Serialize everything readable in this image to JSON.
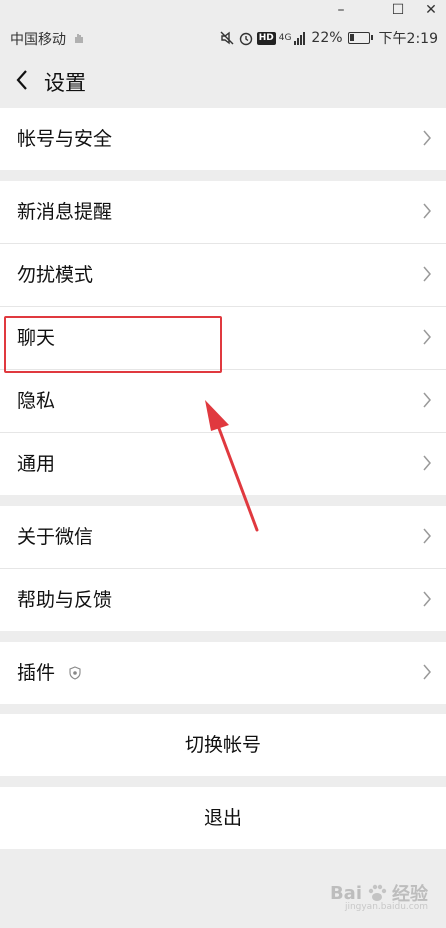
{
  "window": {
    "minimize": "–",
    "maximize": "☐",
    "close": "✕"
  },
  "status": {
    "carrier": "中国移动",
    "hd": "HD",
    "network": "4G",
    "battery": "22%",
    "time": "下午2:19"
  },
  "header": {
    "title": "设置"
  },
  "groups": [
    {
      "items": [
        {
          "label": "帐号与安全"
        }
      ]
    },
    {
      "items": [
        {
          "label": "新消息提醒"
        },
        {
          "label": "勿扰模式"
        },
        {
          "label": "聊天"
        },
        {
          "label": "隐私"
        },
        {
          "label": "通用"
        }
      ]
    },
    {
      "items": [
        {
          "label": "关于微信"
        },
        {
          "label": "帮助与反馈"
        }
      ]
    },
    {
      "items": [
        {
          "label": "插件"
        }
      ]
    }
  ],
  "actions": {
    "switch_account": "切换帐号",
    "logout": "退出"
  },
  "annotation": {
    "highlight_color": "#e0393f"
  },
  "watermark": {
    "text": "Bai",
    "text2": "经验",
    "sub": "jingyan.baidu.com"
  }
}
